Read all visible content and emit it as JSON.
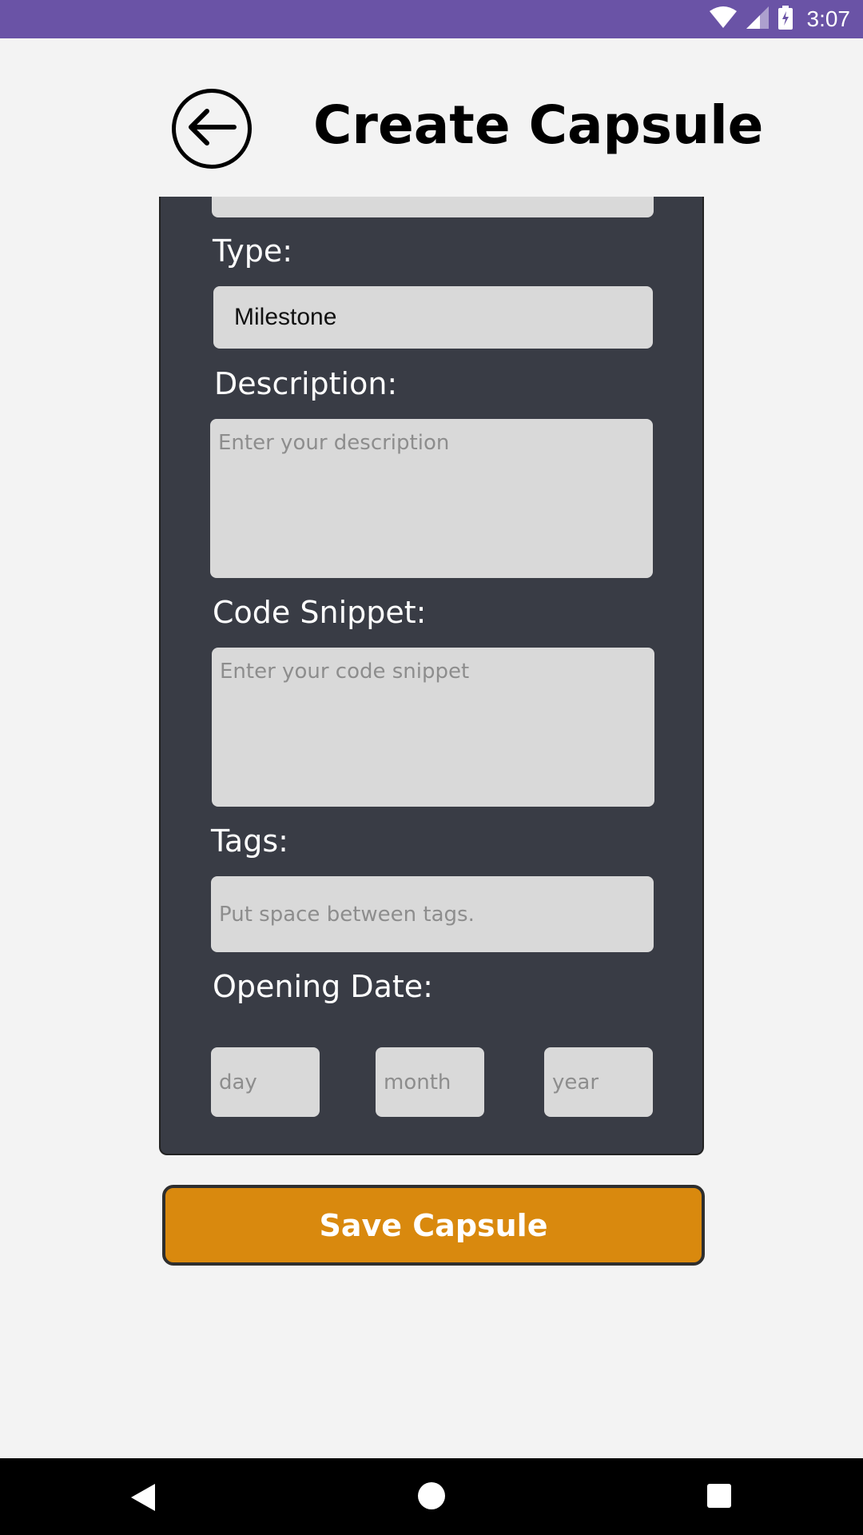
{
  "status_bar": {
    "time": "3:07",
    "icons": [
      "wifi-icon",
      "cell-signal-icon",
      "battery-charging-icon"
    ]
  },
  "header": {
    "title": "Create Capsule",
    "back_icon": "arrow-left-icon"
  },
  "form": {
    "type": {
      "label": "Type:",
      "value": "Milestone"
    },
    "description": {
      "label": "Description:",
      "placeholder": "Enter your description"
    },
    "code_snippet": {
      "label": "Code Snippet:",
      "placeholder": "Enter your code snippet"
    },
    "tags": {
      "label": "Tags:",
      "placeholder": "Put space between tags."
    },
    "opening_date": {
      "label": "Opening Date:",
      "day_placeholder": "day",
      "month_placeholder": "month",
      "year_placeholder": "year"
    }
  },
  "actions": {
    "save_label": "Save Capsule"
  },
  "nav_bar": {
    "icons": [
      "nav-back-icon",
      "nav-home-icon",
      "nav-recents-icon"
    ]
  },
  "colors": {
    "status_bar": "#6a53a6",
    "panel": "#393c45",
    "field": "#d9d9d9",
    "save_button": "#d9890e",
    "background": "#f3f3f3"
  }
}
